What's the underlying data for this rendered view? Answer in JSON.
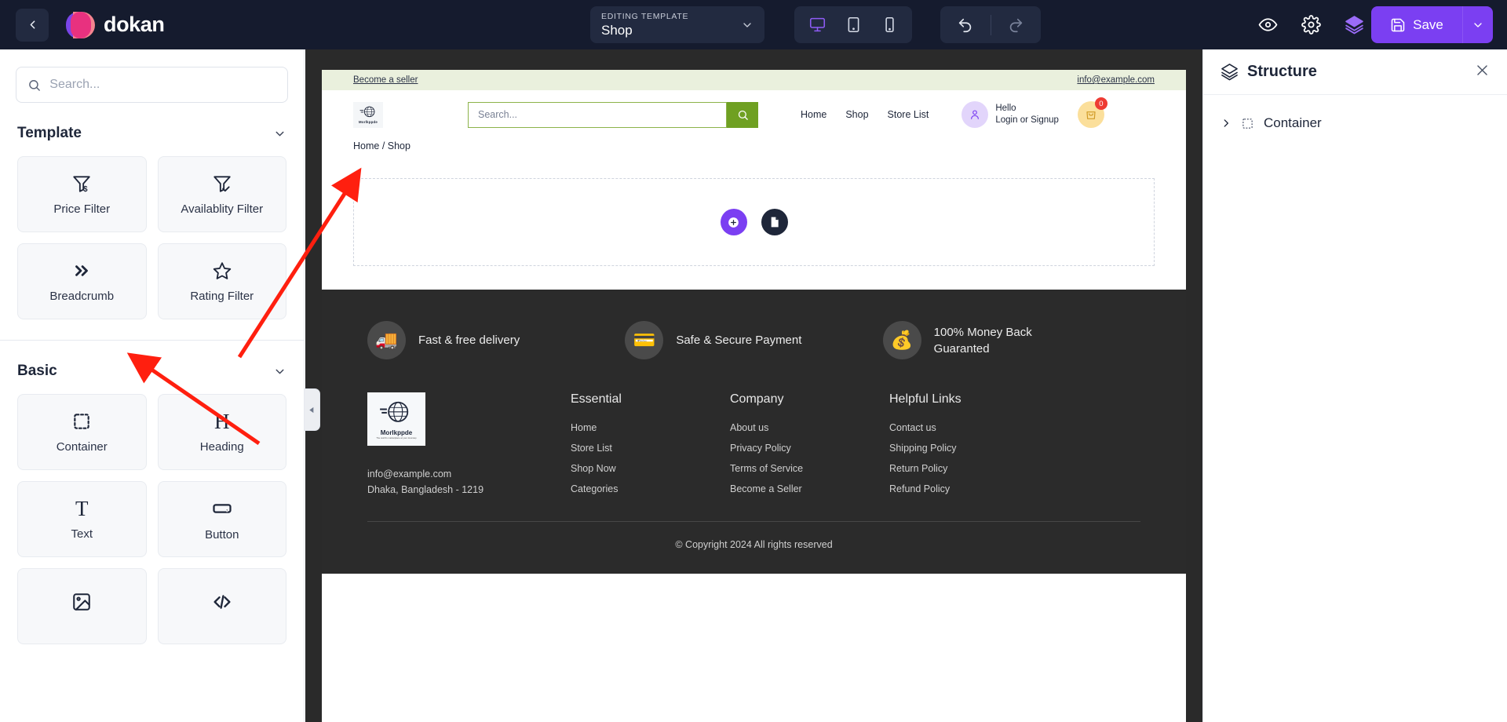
{
  "topbar": {
    "back_icon": "chevron-left-icon",
    "brand": "dokan",
    "template_selector": {
      "kicker": "EDITING TEMPLATE",
      "value": "Shop",
      "caret": "chevron-down-icon"
    },
    "devices": [
      {
        "name": "desktop",
        "icon": "monitor-icon",
        "active": true
      },
      {
        "name": "tablet",
        "icon": "tablet-icon",
        "active": false
      },
      {
        "name": "mobile",
        "icon": "mobile-icon",
        "active": false
      }
    ],
    "history": [
      {
        "name": "undo",
        "icon": "undo-icon",
        "enabled": true
      },
      {
        "name": "redo",
        "icon": "redo-icon",
        "enabled": false
      }
    ],
    "right_icons": [
      {
        "name": "preview",
        "icon": "eye-icon"
      },
      {
        "name": "settings",
        "icon": "gear-icon"
      },
      {
        "name": "structure",
        "icon": "layers-icon"
      }
    ],
    "save": {
      "label": "Save",
      "icon": "save-disk-icon",
      "caret": "chevron-down-icon"
    },
    "accent": "#7b3ff2"
  },
  "left_panel": {
    "search": {
      "placeholder": "Search...",
      "value": "",
      "icon": "search-icon"
    },
    "sections": [
      {
        "title": "Template",
        "caret": "chevron-down-icon",
        "widgets": [
          {
            "label": "Price Filter",
            "icon": "funnel-dollar-icon"
          },
          {
            "label": "Availablity Filter",
            "icon": "funnel-check-icon"
          },
          {
            "label": "Breadcrumb",
            "icon": "double-chevron-right-icon"
          },
          {
            "label": "Rating Filter",
            "icon": "star-icon"
          }
        ]
      },
      {
        "title": "Basic",
        "caret": "chevron-down-icon",
        "widgets": [
          {
            "label": "Container",
            "icon": "dashed-square-icon"
          },
          {
            "label": "Heading",
            "icon": "heading-h-icon"
          },
          {
            "label": "Text",
            "icon": "text-t-icon"
          },
          {
            "label": "Button",
            "icon": "button-icon"
          },
          {
            "label": "",
            "icon": "image-icon"
          },
          {
            "label": "",
            "icon": "code-icon"
          }
        ]
      }
    ],
    "collapse_handle_icon": "triangle-left-icon"
  },
  "canvas": {
    "topstrip": {
      "left_link": "Become a seller",
      "right_link": "info@example.com"
    },
    "header": {
      "logo_text": "Morlkppde",
      "search": {
        "placeholder": "Search...",
        "button_icon": "search-icon"
      },
      "nav": [
        "Home",
        "Shop",
        "Store List"
      ],
      "account": {
        "greeting": "Hello",
        "action": "Login or Signup",
        "icon": "user-icon"
      },
      "cart": {
        "count": "0",
        "icon": "bag-icon"
      }
    },
    "breadcrumb": "Home / Shop",
    "dropzone": {
      "add_icon": "plus-circle-icon",
      "template_icon": "document-icon"
    },
    "features": [
      {
        "label": "Fast & free delivery",
        "icon": "delivery-truck-icon"
      },
      {
        "label": "Safe & Secure Payment",
        "icon": "secure-card-icon"
      },
      {
        "label": "100% Money Back Guaranted",
        "icon": "money-back-icon"
      }
    ],
    "footer": {
      "brand_logo_text": "Morlkppde",
      "brand_tagline": "The world's marketplace at your doorstep",
      "email": "info@example.com",
      "address": "Dhaka, Bangladesh - 1219",
      "columns": [
        {
          "title": "Essential",
          "links": [
            "Home",
            "Store List",
            "Shop Now",
            "Categories"
          ]
        },
        {
          "title": "Company",
          "links": [
            "About us",
            "Privacy Policy",
            "Terms of Service",
            "Become a Seller"
          ]
        },
        {
          "title": "Helpful Links",
          "links": [
            "Contact us",
            "Shipping Policy",
            "Return Policy",
            "Refund Policy"
          ]
        }
      ],
      "copyright": "© Copyright 2024 All rights reserved"
    }
  },
  "right_panel": {
    "title": "Structure",
    "title_icon": "layers-icon",
    "close_icon": "close-icon",
    "tree": [
      {
        "label": "Container",
        "expand_icon": "chevron-right-icon",
        "type_icon": "dashed-square-icon"
      }
    ]
  },
  "annotations": {
    "arrow_color": "#ff1f0f",
    "arrows": 2
  }
}
